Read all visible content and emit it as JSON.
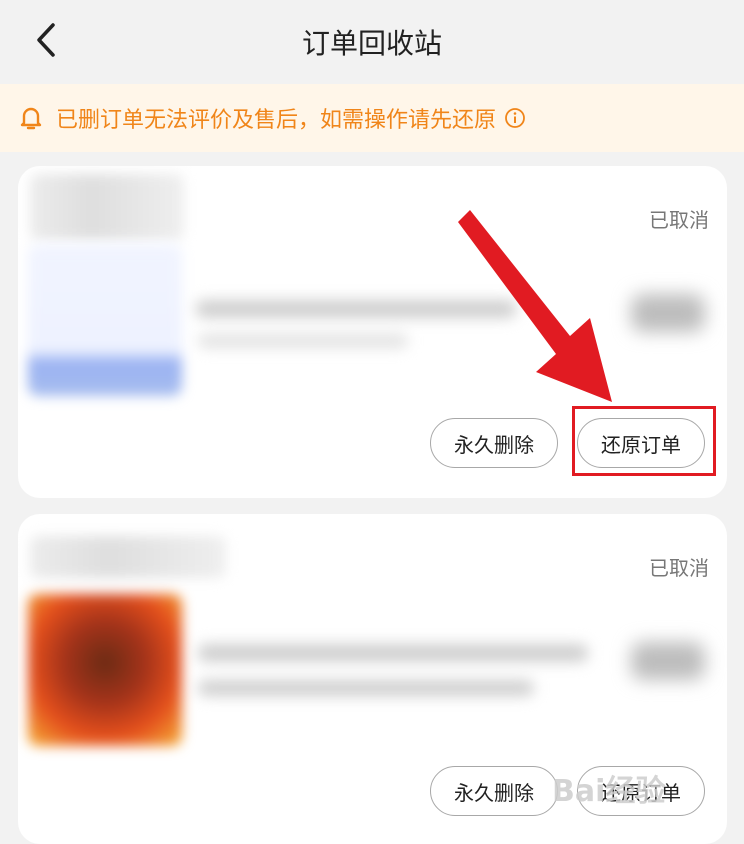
{
  "header": {
    "title": "订单回收站",
    "back_icon": "chevron-left-icon"
  },
  "notice": {
    "text": "已删订单无法评价及售后，如需操作请先还原",
    "icon": "bell-icon",
    "info_icon": "info-icon",
    "color": "#f08519",
    "background": "#fff6e9"
  },
  "orders": [
    {
      "status": "已取消",
      "delete_label": "永久删除",
      "restore_label": "还原订单"
    },
    {
      "status": "已取消",
      "delete_label": "永久删除",
      "restore_label": "还原订单"
    }
  ],
  "annotation": {
    "arrow_color": "#e11b22",
    "box_color": "#e11b22"
  },
  "watermark": {
    "text": "Bai经验"
  }
}
